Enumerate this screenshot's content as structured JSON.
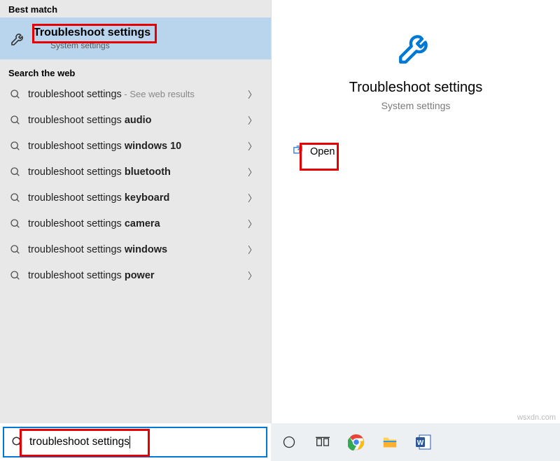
{
  "left": {
    "best_match_header": "Best match",
    "best_match": {
      "title": "Troubleshoot settings",
      "subtitle": "System settings"
    },
    "web_header": "Search the web",
    "items": [
      {
        "prefix": "troubleshoot settings",
        "suffix": "",
        "trail": " - See web results"
      },
      {
        "prefix": "troubleshoot settings ",
        "suffix": "audio",
        "trail": ""
      },
      {
        "prefix": "troubleshoot settings ",
        "suffix": "windows 10",
        "trail": ""
      },
      {
        "prefix": "troubleshoot settings ",
        "suffix": "bluetooth",
        "trail": ""
      },
      {
        "prefix": "troubleshoot settings ",
        "suffix": "keyboard",
        "trail": ""
      },
      {
        "prefix": "troubleshoot settings ",
        "suffix": "camera",
        "trail": ""
      },
      {
        "prefix": "troubleshoot settings ",
        "suffix": "windows",
        "trail": ""
      },
      {
        "prefix": "troubleshoot settings ",
        "suffix": "power",
        "trail": ""
      }
    ]
  },
  "preview": {
    "title": "Troubleshoot settings",
    "subtitle": "System settings",
    "open": "Open"
  },
  "search": {
    "value": "troubleshoot settings"
  },
  "watermark": "wsxdn.com"
}
